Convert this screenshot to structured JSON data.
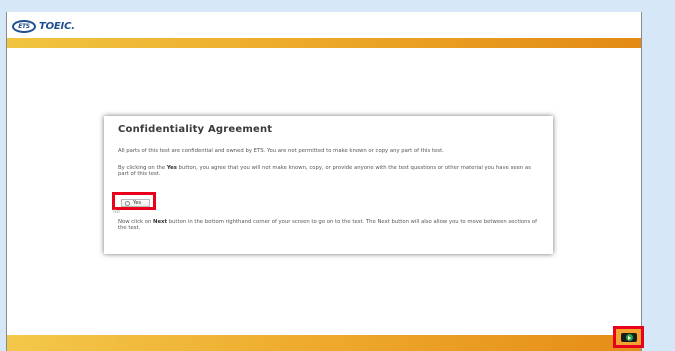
{
  "header": {
    "logo_mark": "ETS",
    "logo_word": "TOEIC."
  },
  "dialog": {
    "title": "Confidentiality Agreement",
    "paragraph1": "All parts of this test are confidential and owned by ETS. You are not permitted to make known or copy any part of this test.",
    "paragraph2_prefix": "By clicking on the ",
    "paragraph2_bold": "Yes",
    "paragraph2_suffix": " button, you agree that you will not make known, copy, or provide anyone with the test questions or other material you have seen as part of this test.",
    "yes_label": "Yes",
    "no_label": "No",
    "paragraph3_prefix": "Now click on ",
    "paragraph3_bold": "Next",
    "paragraph3_suffix": " button in the bottom righthand corner of your screen to go on to the test. The Next button will also allow you to move between sections of the test."
  },
  "colors": {
    "background": "#d6e7f7",
    "highlight": "#e8001c",
    "bar": "#edab2a",
    "logo": "#1f4f8f"
  },
  "icons": {
    "next": "play-circle-icon"
  }
}
